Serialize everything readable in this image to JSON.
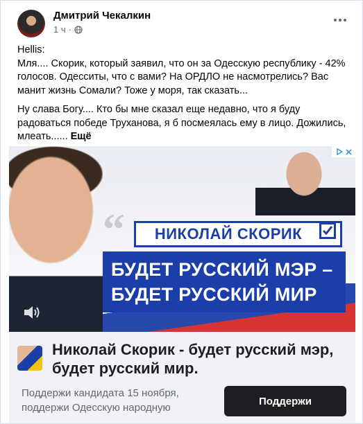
{
  "post": {
    "author": "Дмитрий Чекалкин",
    "time": "1 ч",
    "dot": "·",
    "paragraphs": [
      "Hellis:\nМля.... Скорик, который заявил, что он за Одесскую республику - 42% голосов. Одесситы, что с вами? На ОРДЛО не насмотрелись? Вас манит жизнь Сомали? Тоже у моря, так сказать...",
      "Ну слава Богу.... Кто бы мне сказал еще недавно, что я буду радоваться победе Труханова, я б посмеялась ему в лицо. Дожились, млеать......"
    ],
    "more_label": "Ещё"
  },
  "ad": {
    "banner_name": "НИКОЛАЙ СКОРИК",
    "slogan_line1": "БУДЕТ РУССКИЙ МЭР –",
    "slogan_line2": "БУДЕТ РУССКИЙ МИР",
    "quote_glyph": "“",
    "title": "Николай Скорик - будет русский мэр, будет русский мир.",
    "description": "Поддержи кандидата 15 ноября, поддержи Одесскую народную",
    "cta_label": "Поддержи"
  },
  "colors": {
    "accent_blue": "#1c3ea8",
    "flag_red": "#d42a2a",
    "cta_bg": "#1c1e21"
  }
}
